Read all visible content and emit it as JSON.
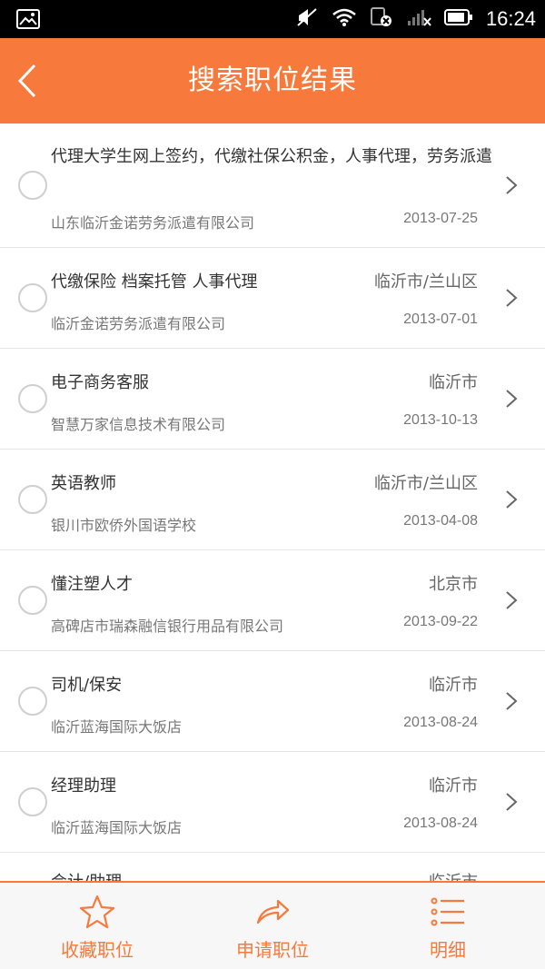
{
  "status_bar": {
    "time": "16:24"
  },
  "header": {
    "title": "搜索职位结果"
  },
  "jobs": [
    {
      "title": "代理大学生网上签约，代缴社保公积金，人事代理，劳务派遣",
      "location": "",
      "company": "山东临沂金诺劳务派遣有限公司",
      "date": "2013-07-25"
    },
    {
      "title": "代缴保险  档案托管 人事代理",
      "location": "临沂市/兰山区",
      "company": "临沂金诺劳务派遣有限公司",
      "date": "2013-07-01"
    },
    {
      "title": "电子商务客服",
      "location": "临沂市",
      "company": "智慧万家信息技术有限公司",
      "date": "2013-10-13"
    },
    {
      "title": "英语教师",
      "location": "临沂市/兰山区",
      "company": "银川市欧侨外国语学校",
      "date": "2013-04-08"
    },
    {
      "title": "懂注塑人才",
      "location": "北京市",
      "company": "高碑店市瑞森融信银行用品有限公司",
      "date": "2013-09-22"
    },
    {
      "title": "司机/保安",
      "location": "临沂市",
      "company": "临沂蓝海国际大饭店",
      "date": "2013-08-24"
    },
    {
      "title": "经理助理",
      "location": "临沂市",
      "company": "临沂蓝海国际大饭店",
      "date": "2013-08-24"
    },
    {
      "title": "会计/助理",
      "location": "临沂市",
      "company": "",
      "date": ""
    }
  ],
  "bottom_tabs": {
    "favorite": "收藏职位",
    "apply": "申请职位",
    "detail": "明细"
  },
  "colors": {
    "accent": "#f77a3c"
  }
}
